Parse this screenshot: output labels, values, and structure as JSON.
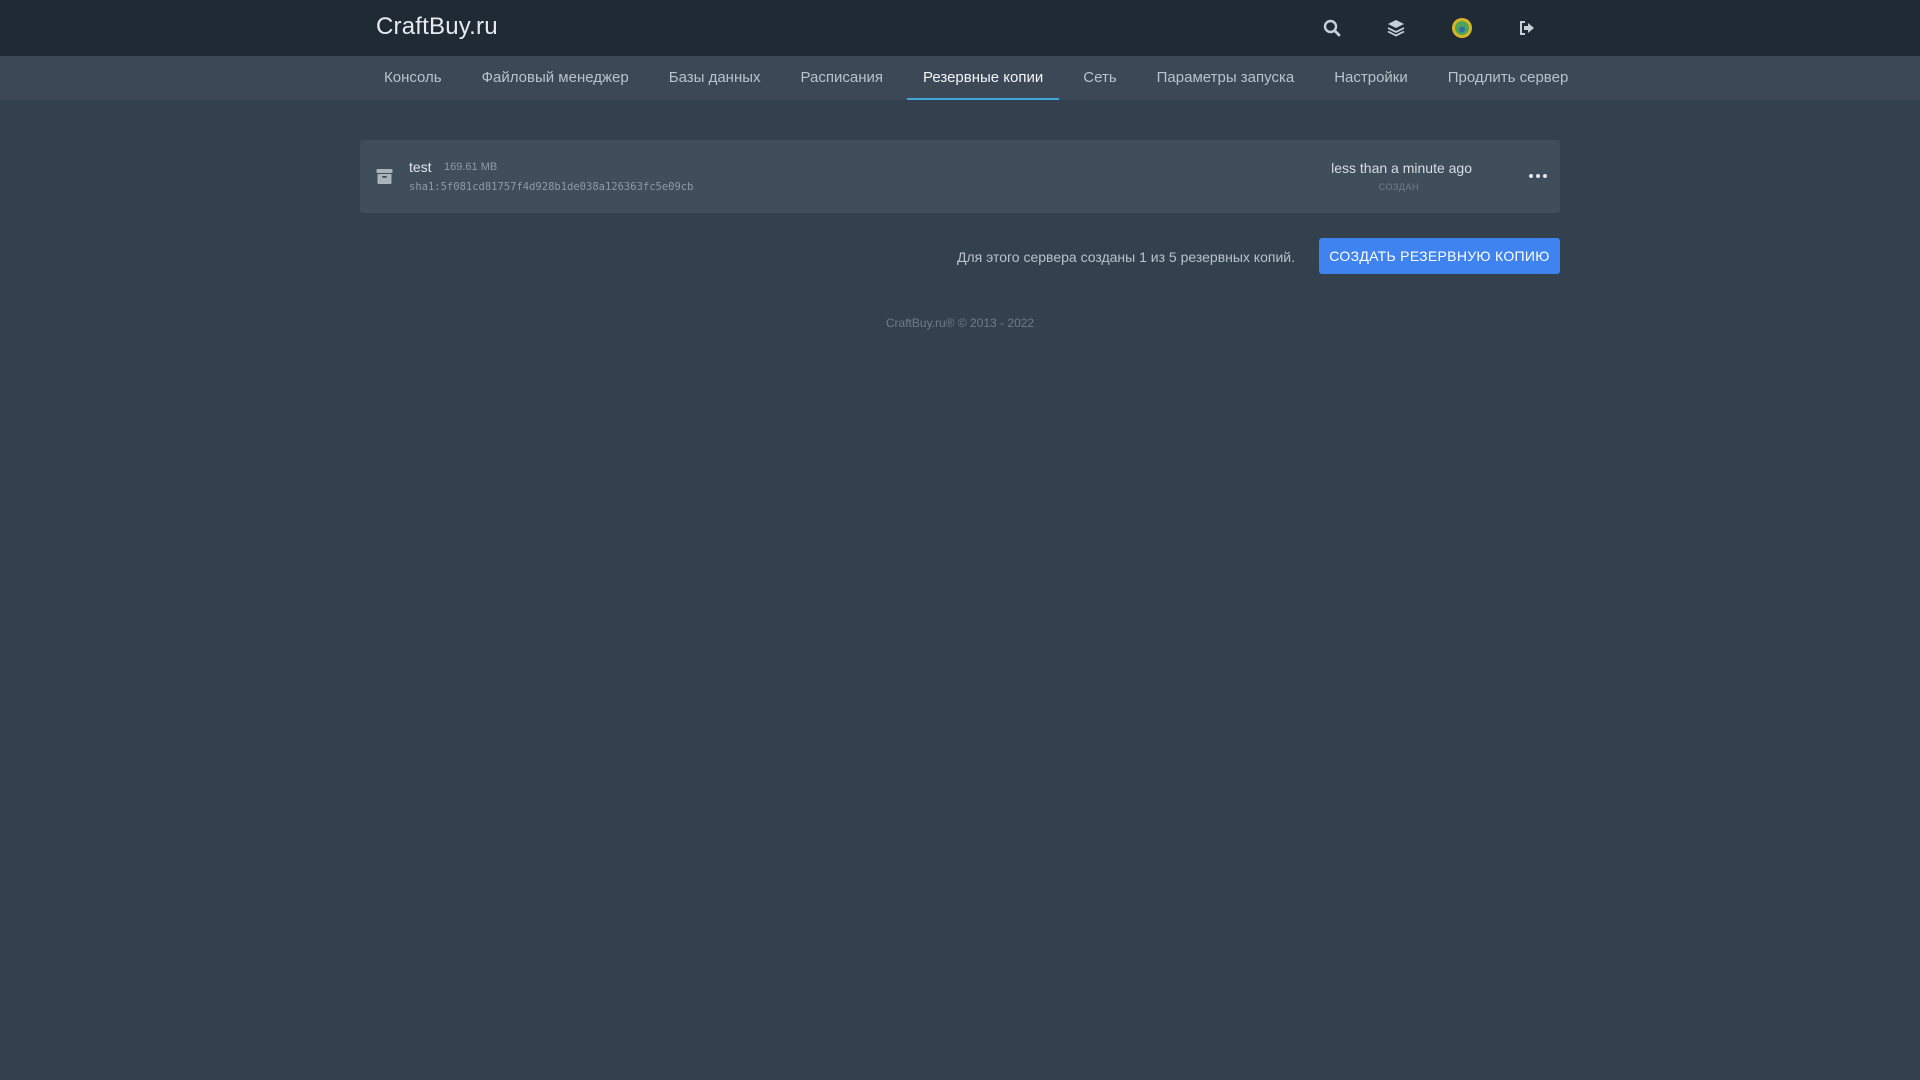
{
  "header": {
    "brand": "CraftBuy.ru",
    "icons": [
      "search-icon",
      "layers-icon",
      "avatar",
      "logout-icon"
    ]
  },
  "nav": {
    "tabs": [
      {
        "label": "Консоль"
      },
      {
        "label": "Файловый менеджер"
      },
      {
        "label": "Базы данных"
      },
      {
        "label": "Расписания"
      },
      {
        "label": "Резервные копии",
        "active": true
      },
      {
        "label": "Сеть"
      },
      {
        "label": "Параметры запуска"
      },
      {
        "label": "Настройки"
      },
      {
        "label": "Продлить сервер"
      }
    ]
  },
  "backups": [
    {
      "name": "test",
      "size": "169.61 MB",
      "hash": "sha1:5f081cd81757f4d928b1de038a126363fc5e09cb",
      "date": "less than a minute ago",
      "date_label": "СОЗДАН"
    }
  ],
  "summary": {
    "count_text": "Для этого сервера созданы 1 из 5 резервных копий.",
    "create_label": "СОЗДАТЬ РЕЗЕРВНУЮ КОПИЮ"
  },
  "footer": {
    "text": "CraftBuy.ru® © 2013 - 2022"
  },
  "colors": {
    "background": "#33404d",
    "topbar": "#202a35",
    "navbar": "#3c4856",
    "card": "#404d5b",
    "accent": "#3f83f0",
    "tab_underline": "#3fa8d8"
  }
}
